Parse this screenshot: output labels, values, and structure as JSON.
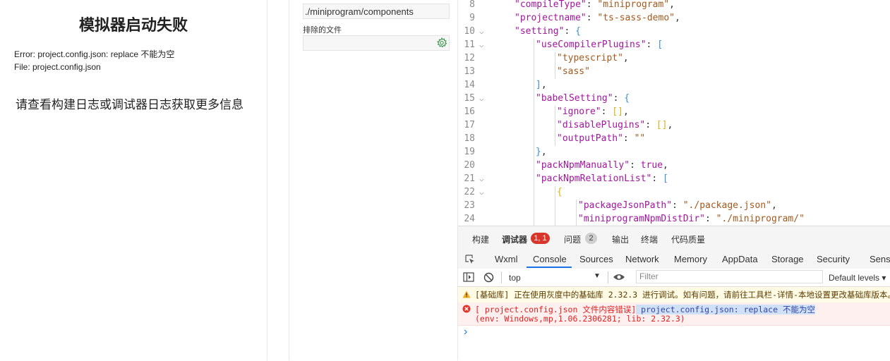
{
  "simulator": {
    "title": "模拟器启动失败",
    "error_line": "Error: project.config.json: replace 不能为空",
    "file_line": "File: project.config.json",
    "more_info": "请查看构建日志或调试器日志获取更多信息"
  },
  "settings": {
    "path_value": "./miniprogram/components",
    "excluded_label": "排除的文件",
    "excluded_value": ""
  },
  "editor": {
    "lines": [
      {
        "num": "8",
        "fold": false,
        "indent": 1,
        "html": "<span class='k'>\"compileType\"</span><span class='p'>: </span><span class='s'>\"miniprogram\"</span><span class='p'>,</span>"
      },
      {
        "num": "9",
        "fold": false,
        "indent": 1,
        "html": "<span class='k'>\"projectname\"</span><span class='p'>: </span><span class='s'>\"ts-sass-demo\"</span><span class='p'>,</span>"
      },
      {
        "num": "10",
        "fold": true,
        "indent": 1,
        "html": "<span class='k'>\"setting\"</span><span class='p'>: </span><span class='br1'>{</span>"
      },
      {
        "num": "11",
        "fold": true,
        "indent": 2,
        "html": "<span class='k'>\"useCompilerPlugins\"</span><span class='p'>: </span><span class='br1'>[</span>"
      },
      {
        "num": "12",
        "fold": false,
        "indent": 3,
        "html": "<span class='s'>\"typescript\"</span><span class='p'>,</span>"
      },
      {
        "num": "13",
        "fold": false,
        "indent": 3,
        "html": "<span class='s'>\"sass\"</span>"
      },
      {
        "num": "14",
        "fold": false,
        "indent": 2,
        "html": "<span class='br1'>]</span><span class='p'>,</span>"
      },
      {
        "num": "15",
        "fold": true,
        "indent": 2,
        "html": "<span class='k'>\"babelSetting\"</span><span class='p'>: </span><span class='br1'>{</span>"
      },
      {
        "num": "16",
        "fold": false,
        "indent": 3,
        "html": "<span class='k'>\"ignore\"</span><span class='p'>: </span><span class='br2'>[]</span><span class='p'>,</span>"
      },
      {
        "num": "17",
        "fold": false,
        "indent": 3,
        "html": "<span class='k'>\"disablePlugins\"</span><span class='p'>: </span><span class='br2'>[]</span><span class='p'>,</span>"
      },
      {
        "num": "18",
        "fold": false,
        "indent": 3,
        "html": "<span class='k'>\"outputPath\"</span><span class='p'>: </span><span class='s'>\"\"</span>"
      },
      {
        "num": "19",
        "fold": false,
        "indent": 2,
        "html": "<span class='br1'>}</span><span class='p'>,</span>"
      },
      {
        "num": "20",
        "fold": false,
        "indent": 2,
        "html": "<span class='k'>\"packNpmManually\"</span><span class='p'>: </span><span class='k'>true</span><span class='p'>,</span>"
      },
      {
        "num": "21",
        "fold": true,
        "indent": 2,
        "html": "<span class='k'>\"packNpmRelationList\"</span><span class='p'>: </span><span class='br1'>[</span>"
      },
      {
        "num": "22",
        "fold": true,
        "indent": 3,
        "html": "<span class='br2'>{</span>"
      },
      {
        "num": "23",
        "fold": false,
        "indent": 4,
        "html": "<span class='k'>\"packageJsonPath\"</span><span class='p'>: </span><span class='s'>\"./package.json\"</span><span class='p'>,</span>"
      },
      {
        "num": "24",
        "fold": false,
        "indent": 4,
        "html": "<span class='k'>\"miniprogramNpmDistDir\"</span><span class='p'>: </span><span class='s'>\"./miniprogram/\"</span>"
      }
    ]
  },
  "devtools": {
    "top_tabs": [
      "构建",
      "调试器",
      "问题",
      "输出",
      "终端",
      "代码质量"
    ],
    "debugger_badge": "1, 1",
    "problems_badge": "2",
    "tabs": [
      "Wxml",
      "Console",
      "Sources",
      "Network",
      "Memory",
      "AppData",
      "Storage",
      "Security",
      "Sensor"
    ],
    "active_tab": "Console",
    "context": "top",
    "filter_placeholder": "Filter",
    "levels": "Default levels ▾",
    "warning": "[基础库] 正在使用灰度中的基础库 2.32.3 进行调试。如有问题，请前往工具栏-详情-本地设置更改基础库版本。",
    "error_prefix": "[ project.config.json 文件内容错误]",
    "error_highlight": " project.config.json: replace 不能为空",
    "error_env": "(env: Windows,mp,1.06.2306281; lib: 2.32.3)",
    "prompt": "›"
  }
}
